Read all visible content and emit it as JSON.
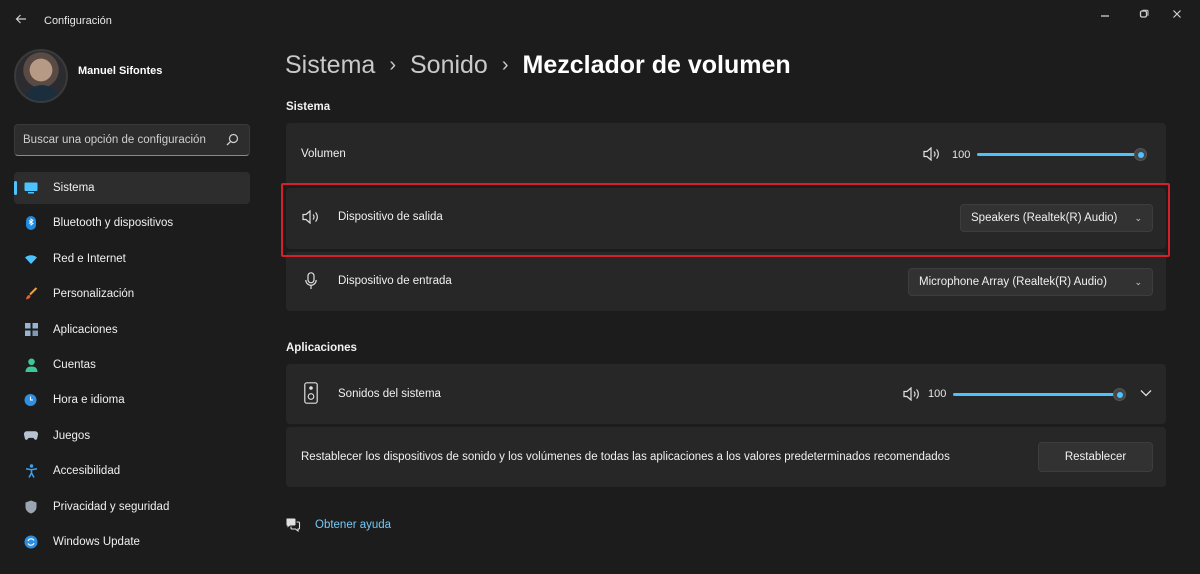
{
  "window": {
    "title": "Configuración",
    "controls": [
      "minimize",
      "restore",
      "close"
    ]
  },
  "user": {
    "name": "Manuel Sifontes"
  },
  "search": {
    "placeholder": "Buscar una opción de configuración"
  },
  "sidebar": {
    "items": [
      {
        "label": "Sistema",
        "icon": "monitor-icon",
        "active": true
      },
      {
        "label": "Bluetooth y dispositivos",
        "icon": "bluetooth-icon"
      },
      {
        "label": "Red e Internet",
        "icon": "wifi-icon"
      },
      {
        "label": "Personalización",
        "icon": "brush-icon"
      },
      {
        "label": "Aplicaciones",
        "icon": "apps-icon"
      },
      {
        "label": "Cuentas",
        "icon": "person-icon"
      },
      {
        "label": "Hora e idioma",
        "icon": "globe-clock-icon"
      },
      {
        "label": "Juegos",
        "icon": "gamepad-icon"
      },
      {
        "label": "Accesibilidad",
        "icon": "accessibility-icon"
      },
      {
        "label": "Privacidad y seguridad",
        "icon": "shield-icon"
      },
      {
        "label": "Windows Update",
        "icon": "update-icon"
      }
    ]
  },
  "breadcrumb": {
    "level1": "Sistema",
    "level2": "Sonido",
    "current": "Mezclador de volumen",
    "separator": "›"
  },
  "sistema": {
    "heading": "Sistema",
    "volume": {
      "label": "Volumen",
      "value": "100",
      "level": 1.0
    },
    "output": {
      "label": "Dispositivo de salida",
      "device": "Speakers (Realtek(R) Audio)"
    },
    "input": {
      "label": "Dispositivo de entrada",
      "device": "Microphone Array (Realtek(R) Audio)"
    }
  },
  "aplicaciones": {
    "heading": "Aplicaciones",
    "system_sounds": {
      "label": "Sonidos del sistema",
      "value": "100",
      "level": 1.0
    },
    "reset": {
      "text": "Restablecer los dispositivos de sonido y los volúmenes de todas las aplicaciones a los valores predeterminados recomendados",
      "button": "Restablecer"
    }
  },
  "help": {
    "label": "Obtener ayuda"
  },
  "colors": {
    "accent": "#4cc2ff",
    "highlight": "#d4202c",
    "background": "#1c1c1c",
    "card": "#272727"
  }
}
